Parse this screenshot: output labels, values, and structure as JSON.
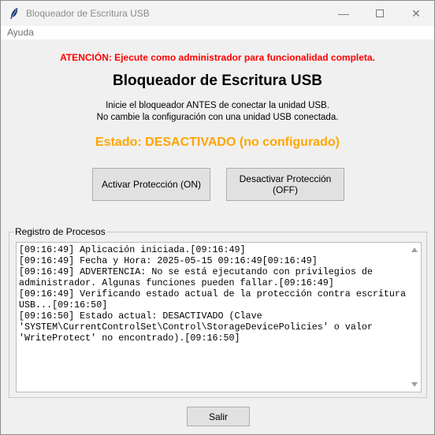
{
  "window": {
    "title": "Bloqueador de Escritura USB"
  },
  "menu": {
    "items": [
      "Ayuda"
    ]
  },
  "warning": "ATENCIÓN: Ejecute como administrador para funcionalidad completa.",
  "heading": "Bloqueador de Escritura USB",
  "instructions": [
    "Inicie el bloqueador ANTES de conectar la unidad USB.",
    "No cambie la configuración con una unidad USB conectada."
  ],
  "status": "Estado: DESACTIVADO (no configurado)",
  "buttons": {
    "activate": "Activar Protección (ON)",
    "deactivate": "Desactivar Protección (OFF)",
    "exit": "Salir"
  },
  "log": {
    "label": "Registro de Procesos",
    "lines": [
      "[09:16:49] Aplicación iniciada.[09:16:49]",
      "[09:16:49] Fecha y Hora: 2025-05-15 09:16:49[09:16:49]",
      "[09:16:49] ADVERTENCIA: No se está ejecutando con privilegios de",
      "administrador. Algunas funciones pueden fallar.[09:16:49]",
      "[09:16:49] Verificando estado actual de la protección contra escritura",
      "USB...[09:16:50]",
      "[09:16:50] Estado actual: DESACTIVADO (Clave",
      "'SYSTEM\\CurrentControlSet\\Control\\StorageDevicePolicies' o valor",
      "'WriteProtect' no encontrado).[09:16:50]"
    ]
  },
  "colors": {
    "warning": "#ff0000",
    "status": "#ffa500"
  }
}
